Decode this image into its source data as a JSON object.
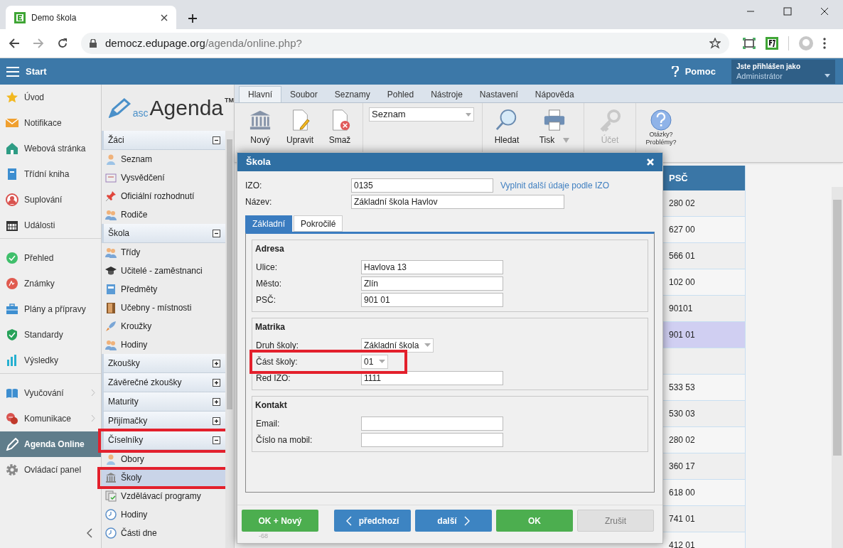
{
  "browser": {
    "tab_title": "Demo škola",
    "url_host": "democz.edupage.org",
    "url_path": "/agenda/online.php?"
  },
  "header": {
    "menu_label": "Start",
    "help_label": "Pomoc",
    "user_caption": "Jste přihlášen jako",
    "user_name": "Administrátor"
  },
  "nav": {
    "groups": [
      [
        {
          "label": "Úvod",
          "selected": false,
          "submenu": false
        },
        {
          "label": "Notifikace",
          "selected": false,
          "submenu": false
        },
        {
          "label": "Webová stránka",
          "selected": false,
          "submenu": false
        },
        {
          "label": "Třídní kniha",
          "selected": false,
          "submenu": false
        },
        {
          "label": "Suplování",
          "selected": false,
          "submenu": false
        },
        {
          "label": "Události",
          "selected": false,
          "submenu": false
        }
      ],
      [
        {
          "label": "Přehled",
          "selected": false,
          "submenu": false
        },
        {
          "label": "Známky",
          "selected": false,
          "submenu": false
        },
        {
          "label": "Plány a přípravy",
          "selected": false,
          "submenu": false
        },
        {
          "label": "Standardy",
          "selected": false,
          "submenu": false
        },
        {
          "label": "Výsledky",
          "selected": false,
          "submenu": false
        }
      ],
      [
        {
          "label": "Vyučování",
          "selected": false,
          "submenu": true
        },
        {
          "label": "Komunikace",
          "selected": false,
          "submenu": true
        },
        {
          "label": "Agenda Online",
          "selected": true,
          "submenu": false
        },
        {
          "label": "Ovládací panel",
          "selected": false,
          "submenu": false
        }
      ]
    ]
  },
  "agenda": {
    "logo": {
      "prefix": "asc",
      "name": "Agenda",
      "mark": "TM"
    },
    "sections": [
      {
        "title": "Žáci",
        "expanded": true,
        "highlighted": false,
        "items": [
          {
            "label": "Seznam",
            "selected": false,
            "highlighted": false
          },
          {
            "label": "Vysvědčení",
            "selected": false,
            "highlighted": false
          },
          {
            "label": "Oficiální rozhodnutí",
            "selected": false,
            "highlighted": false
          },
          {
            "label": "Rodiče",
            "selected": false,
            "highlighted": false
          }
        ]
      },
      {
        "title": "Škola",
        "expanded": true,
        "highlighted": false,
        "items": [
          {
            "label": "Třídy",
            "selected": false,
            "highlighted": false
          },
          {
            "label": "Učitelé - zaměstnanci",
            "selected": false,
            "highlighted": false
          },
          {
            "label": "Předměty",
            "selected": false,
            "highlighted": false
          },
          {
            "label": "Učebny - místnosti",
            "selected": false,
            "highlighted": false
          },
          {
            "label": "Kroužky",
            "selected": false,
            "highlighted": false
          },
          {
            "label": "Hodiny",
            "selected": false,
            "highlighted": false
          }
        ]
      },
      {
        "title": "Zkoušky",
        "expanded": false,
        "highlighted": false
      },
      {
        "title": "Závěrečné zkoušky",
        "expanded": false,
        "highlighted": false
      },
      {
        "title": "Maturity",
        "expanded": false,
        "highlighted": false
      },
      {
        "title": "Přijímačky",
        "expanded": false,
        "highlighted": false
      },
      {
        "title": "Číselníky",
        "expanded": true,
        "highlighted": true,
        "items": [
          {
            "label": "Obory",
            "selected": false,
            "highlighted": false
          },
          {
            "label": "Školy",
            "selected": true,
            "highlighted": true
          },
          {
            "label": "Vzdělávací programy",
            "selected": false,
            "highlighted": false
          },
          {
            "label": "Hodiny",
            "selected": false,
            "highlighted": false
          },
          {
            "label": "Části dne",
            "selected": false,
            "highlighted": false
          }
        ]
      }
    ]
  },
  "menu_tabs": [
    {
      "label": "Hlavní",
      "selected": true
    },
    {
      "label": "Soubor",
      "selected": false
    },
    {
      "label": "Seznamy",
      "selected": false
    },
    {
      "label": "Pohled",
      "selected": false
    },
    {
      "label": "Nástroje",
      "selected": false
    },
    {
      "label": "Nastavení",
      "selected": false
    },
    {
      "label": "Nápověda",
      "selected": false
    }
  ],
  "toolbar": {
    "record_buttons": [
      {
        "label": "Nový",
        "disabled": false
      },
      {
        "label": "Upravit",
        "disabled": false
      },
      {
        "label": "Smaž",
        "disabled": false
      }
    ],
    "view_select": "Seznam",
    "tool_buttons": [
      {
        "label": "Hledat",
        "disabled": false,
        "dropdown": false
      },
      {
        "label": "Tisk",
        "disabled": false,
        "dropdown": true
      }
    ],
    "account_button": {
      "label": "Účet",
      "disabled": true
    },
    "help_lines": [
      "Otázky?",
      "Problémy?"
    ]
  },
  "table": {
    "columns": [
      "PSČ"
    ],
    "rows": [
      {
        "psc": "280 02",
        "selected": false
      },
      {
        "psc": "627 00",
        "selected": false
      },
      {
        "psc": "566 01",
        "selected": false
      },
      {
        "psc": "102 00",
        "selected": false
      },
      {
        "psc": "90101",
        "selected": false
      },
      {
        "psc": "901 01",
        "selected": true
      },
      {
        "selected": false
      },
      {
        "psc": "533 53",
        "selected": false
      },
      {
        "psc": "530 03",
        "selected": false
      },
      {
        "psc": "280 02",
        "selected": false
      },
      {
        "psc": "360 17",
        "selected": false
      },
      {
        "psc": "618 00",
        "selected": false
      },
      {
        "psc": "741 01",
        "selected": false
      },
      {
        "psc": "412 01",
        "selected": false
      }
    ]
  },
  "dialog": {
    "title": "Škola",
    "top_fields": [
      {
        "label": "IZO:",
        "value": "0135"
      },
      {
        "label": "Název:",
        "value": "Základní škola Havlov"
      }
    ],
    "lookup_link": "Vyplnit další údaje podle IZO",
    "tabs": [
      {
        "label": "Základní",
        "selected": true
      },
      {
        "label": "Pokročilé",
        "selected": false
      }
    ],
    "groups": [
      {
        "title": "Adresa",
        "fields": [
          {
            "label": "Ulice:",
            "kind": "text",
            "value": "Havlova 13",
            "highlighted": false
          },
          {
            "label": "Město:",
            "kind": "text",
            "value": "Zlín",
            "highlighted": false
          },
          {
            "label": "PSČ:",
            "kind": "text",
            "value": "901 01",
            "highlighted": false
          }
        ]
      },
      {
        "title": "Matrika",
        "fields": [
          {
            "label": "Druh školy:",
            "kind": "select",
            "value": "Základní škola",
            "highlighted": false
          },
          {
            "label": "Část školy:",
            "kind": "select",
            "value": "01",
            "highlighted": true
          },
          {
            "label": "Red IZO:",
            "kind": "text",
            "value": "1111",
            "highlighted": false
          }
        ]
      },
      {
        "title": "Kontakt",
        "fields": [
          {
            "label": "Email:",
            "kind": "text",
            "highlighted": false
          },
          {
            "label": "Číslo na mobil:",
            "kind": "text",
            "highlighted": false
          }
        ]
      }
    ],
    "buttons": [
      {
        "label": "OK + Nový",
        "kind": "success"
      },
      {
        "label": "předchozí",
        "kind": "previous"
      },
      {
        "label": "další",
        "kind": "next"
      },
      {
        "label": "OK",
        "kind": "success"
      },
      {
        "label": "Zrušit",
        "kind": "secondary"
      }
    ],
    "footnote": "-68"
  }
}
